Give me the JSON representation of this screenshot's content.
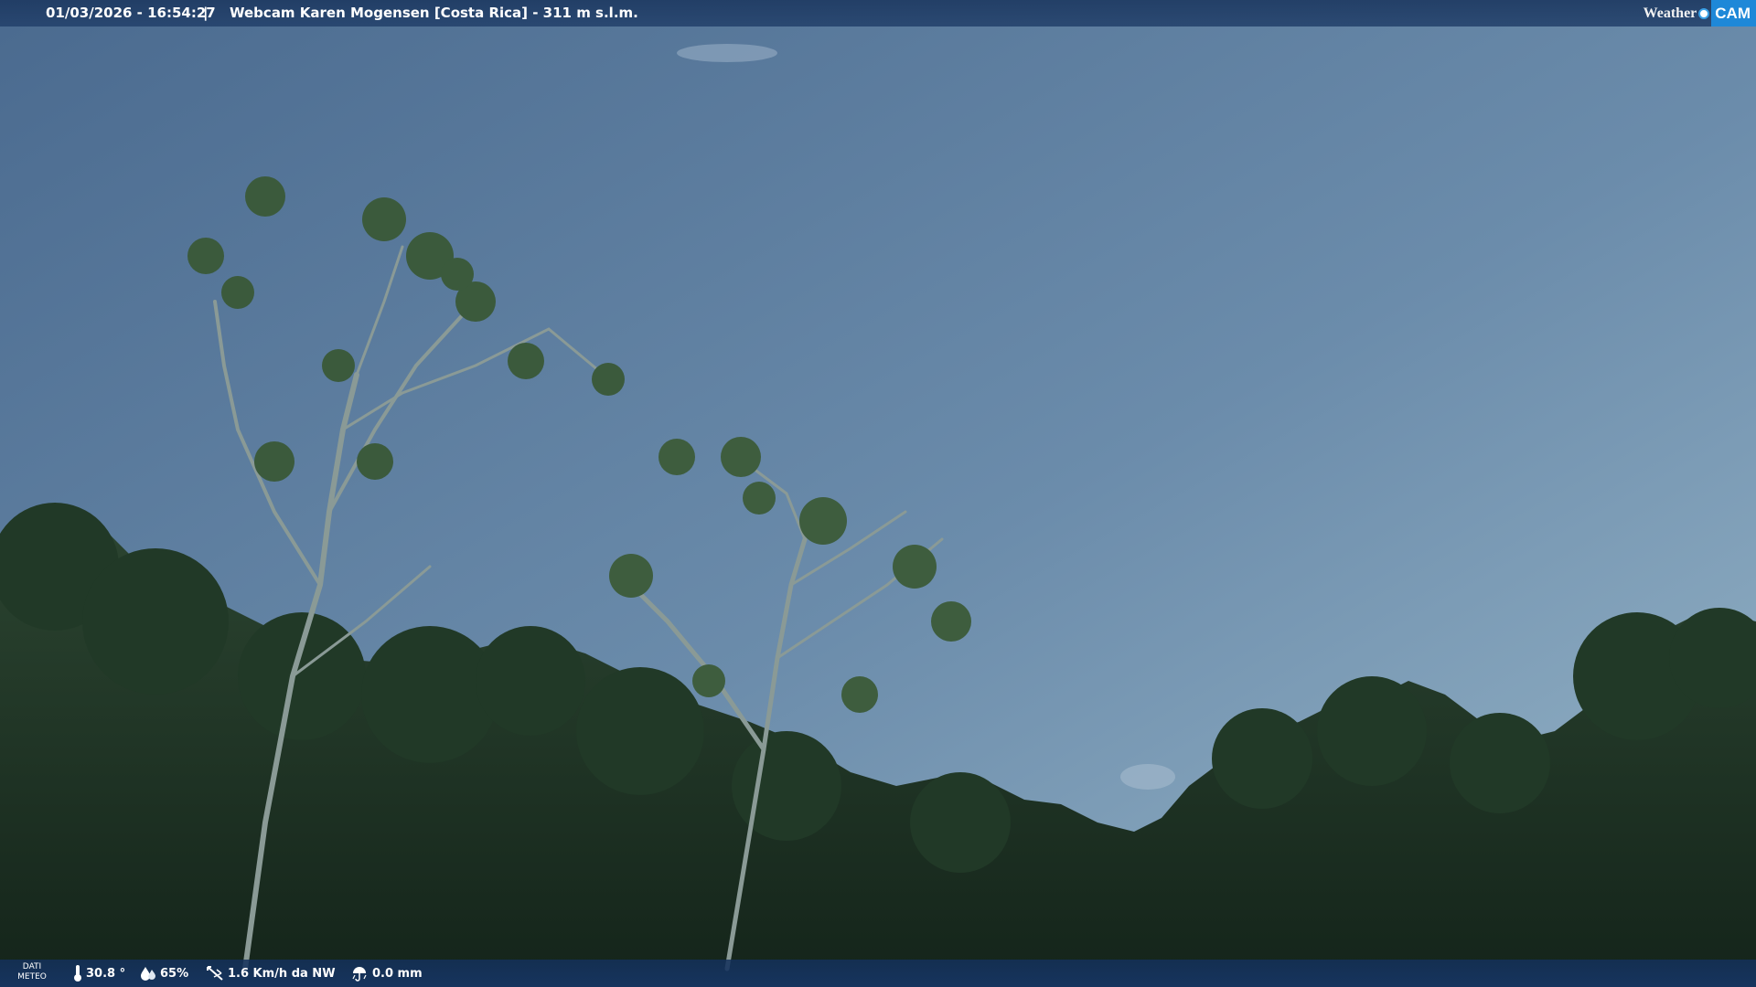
{
  "header": {
    "timestamp": "01/03/2026 - 16:54:27",
    "separator": "|",
    "title": "Webcam Karen Mogensen [Costa Rica] - 311 m s.l.m.",
    "logo": {
      "part1": "Weather",
      "part2": "CAM"
    }
  },
  "footer": {
    "label_line1": "DATI",
    "label_line2": "METEO",
    "temperature": "30.8 °",
    "humidity": "65%",
    "wind": "1.6 Km/h da NW",
    "rain": "0.0 mm",
    "icons": [
      "thermometer-icon",
      "humidity-icon",
      "wind-icon",
      "rain-icon"
    ]
  },
  "colors": {
    "sky_top": "#4f6f93",
    "sky_bottom": "#8fb0c6",
    "forest": "#1f3323",
    "bar": "#1e3a62",
    "logo_accent": "#1e88d8"
  }
}
